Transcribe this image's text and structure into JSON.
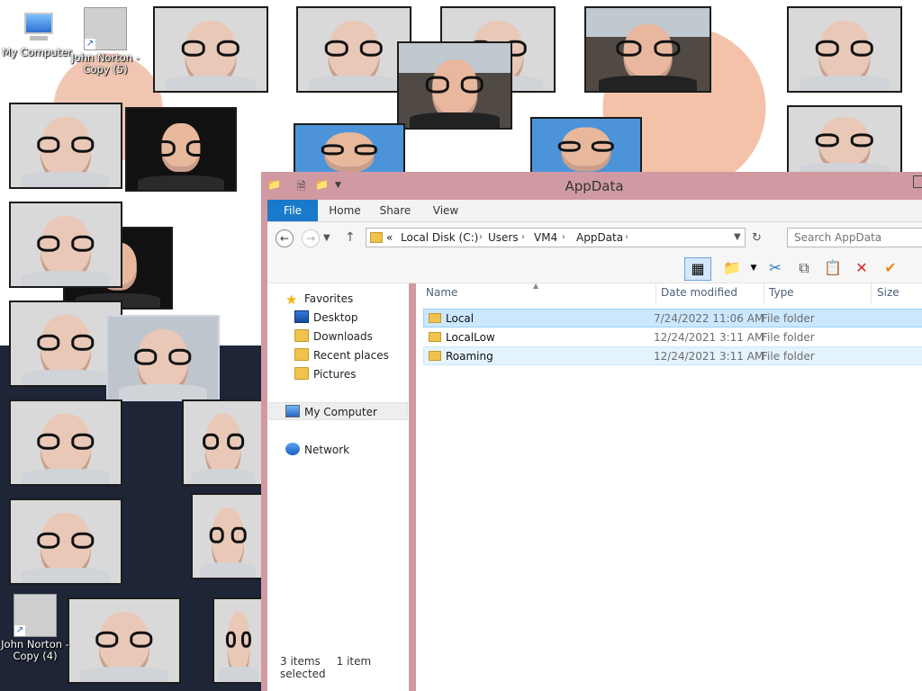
{
  "desktop": {
    "icons": [
      {
        "label": "My Computer",
        "kind": "computer"
      },
      {
        "label": "John Norton - Copy (5)",
        "kind": "shortcut"
      },
      {
        "label": "John Norton - Copy (4)",
        "kind": "shortcut"
      }
    ]
  },
  "window": {
    "title": "AppData",
    "ribbon_tabs": [
      "File",
      "Home",
      "Share",
      "View"
    ],
    "address": {
      "prefix": "«",
      "crumbs": [
        "Local Disk (C:)",
        "Users",
        "VM4",
        "AppData"
      ]
    },
    "search": {
      "placeholder": "Search AppData"
    },
    "toolbar_icons": [
      "preview-pane-icon",
      "properties-icon",
      "cut-icon",
      "copy-icon",
      "paste-icon",
      "delete-icon",
      "check-icon"
    ],
    "nav_pane": {
      "favorites_label": "Favorites",
      "favorites": [
        "Desktop",
        "Downloads",
        "Recent places",
        "Pictures"
      ],
      "my_computer": "My Computer",
      "network": "Network"
    },
    "columns": {
      "name": "Name",
      "date": "Date modified",
      "type": "Type",
      "size": "Size"
    },
    "files": [
      {
        "name": "Local",
        "date": "7/24/2022 11:06 AM",
        "type": "File folder",
        "state": "selected"
      },
      {
        "name": "LocalLow",
        "date": "12/24/2021 3:11 AM",
        "type": "File folder",
        "state": "normal"
      },
      {
        "name": "Roaming",
        "date": "12/24/2021 3:11 AM",
        "type": "File folder",
        "state": "hover"
      }
    ],
    "status": {
      "count": "3 items",
      "selection": "1 item selected"
    }
  },
  "colors": {
    "titlebar": "#d19aa2",
    "file_tab": "#1979ca",
    "selection": "#cce8ff"
  }
}
